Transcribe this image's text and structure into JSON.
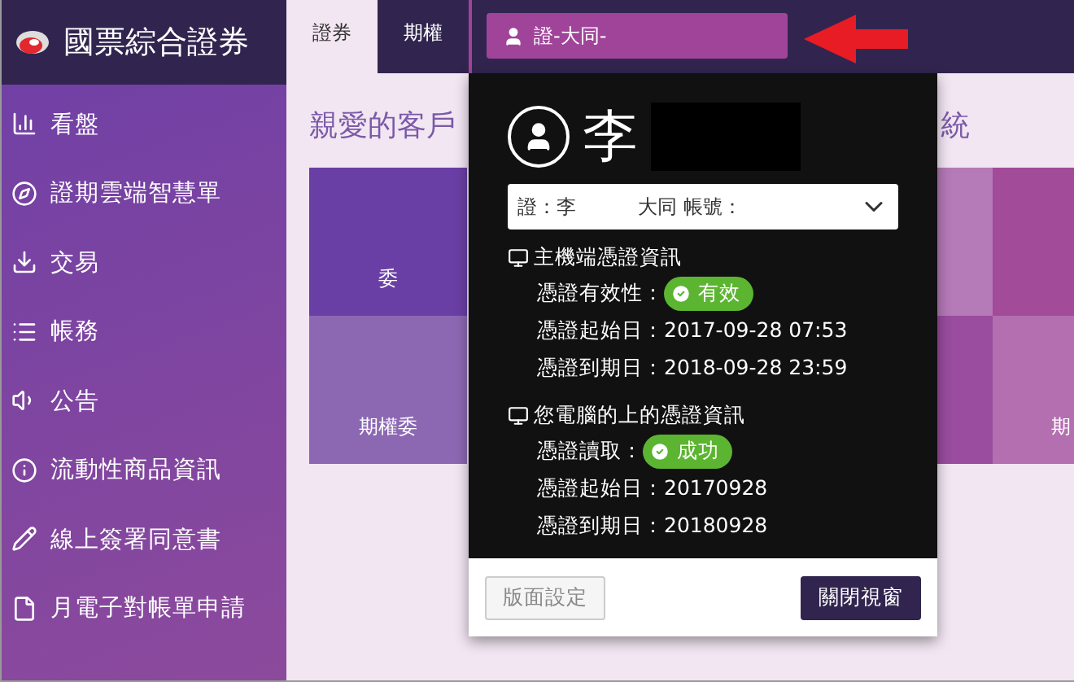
{
  "brand": {
    "name": "國票綜合證券"
  },
  "sidebar": {
    "items": [
      {
        "label": "看盤"
      },
      {
        "label": "證期雲端智慧單"
      },
      {
        "label": "交易"
      },
      {
        "label": "帳務"
      },
      {
        "label": "公告"
      },
      {
        "label": "流動性商品資訊"
      },
      {
        "label": "線上簽署同意書"
      },
      {
        "label": "月電子對帳單申請"
      }
    ]
  },
  "tabs": [
    {
      "label": "證券",
      "selected": true
    },
    {
      "label": "期權",
      "selected": false
    }
  ],
  "account_button": {
    "label": "證-大同-"
  },
  "main": {
    "greeting": "親愛的客戶",
    "heading_tail": "統",
    "tiles": [
      {
        "label": "委"
      },
      {
        "label": "期權委"
      }
    ],
    "right_tile": {
      "label": "期"
    }
  },
  "popup": {
    "name": "李",
    "account_select": {
      "value": "證：李          大同 帳號："
    },
    "sections": [
      {
        "title": "主機端憑證資訊",
        "rows": [
          {
            "kind": "badge",
            "label": "憑證有效性：",
            "value": "有效"
          },
          {
            "kind": "text",
            "label": "憑證起始日：",
            "value": "2017-09-28 07:53"
          },
          {
            "kind": "text",
            "label": "憑證到期日：",
            "value": "2018-09-28 23:59"
          }
        ]
      },
      {
        "title": "您電腦的上的憑證資訊",
        "rows": [
          {
            "kind": "badge",
            "label": "憑證讀取：",
            "value": "成功"
          },
          {
            "kind": "text",
            "label": "憑證起始日：",
            "value": "20170928"
          },
          {
            "kind": "text",
            "label": "憑證到期日：",
            "value": "20180928"
          }
        ]
      }
    ],
    "buttons": [
      {
        "label": "版面設定",
        "disabled": true
      },
      {
        "label": "關閉視窗",
        "disabled": false
      }
    ]
  }
}
